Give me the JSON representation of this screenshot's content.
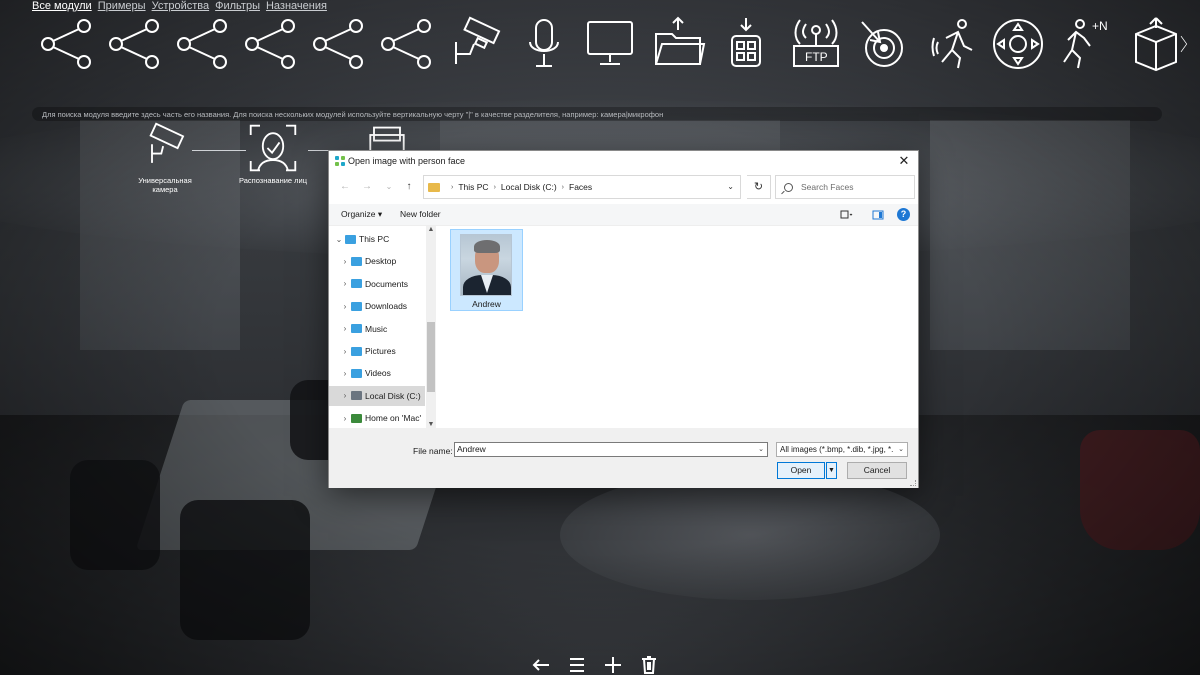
{
  "top_nav": {
    "items": [
      "Все модули",
      "Примеры",
      "Устройства",
      "Фильтры",
      "Назначения"
    ],
    "active_index": 0
  },
  "module_icons": [
    "share-icon",
    "share-icon",
    "share-icon",
    "share-icon",
    "share-icon",
    "share-icon",
    "cctv-camera-icon",
    "microphone-icon",
    "monitor-icon",
    "folder-upload-icon",
    "grid-download-icon",
    "ftp-icon",
    "motion-target-icon",
    "running-person-icon",
    "dpad-icon",
    "person-counter-icon",
    "package-icon",
    "chevron-right-icon"
  ],
  "ftp_label": "FTP",
  "counter_label": "+N",
  "search_hint": "Для поиска модуля введите здесь часть его названия. Для поиска нескольких модулей используйте вертикальную черту \"|\" в качестве разделителя, например: камера|микрофон",
  "pipeline": {
    "nodes": [
      {
        "label": "Универсальная камера",
        "icon": "cctv-camera-icon"
      },
      {
        "label": "Распознавание лиц",
        "icon": "face-recognition-icon"
      },
      {
        "label": "",
        "icon": "file-archive-icon"
      }
    ]
  },
  "bottom_toolbar": [
    "arrow-left-icon",
    "menu-icon",
    "plus-icon",
    "trash-icon"
  ],
  "dialog": {
    "title": "Open image with person face",
    "breadcrumb": [
      "This PC",
      "Local Disk (C:)",
      "Faces"
    ],
    "search_placeholder": "Search Faces",
    "commands": {
      "organize": "Organize ▾",
      "new_folder": "New folder"
    },
    "tree": [
      {
        "label": "This PC",
        "color": "#3aa0e0",
        "expanded": true
      },
      {
        "label": "Desktop",
        "color": "#3aa0e0"
      },
      {
        "label": "Documents",
        "color": "#3aa0e0"
      },
      {
        "label": "Downloads",
        "color": "#3aa0e0"
      },
      {
        "label": "Music",
        "color": "#3aa0e0"
      },
      {
        "label": "Pictures",
        "color": "#3aa0e0"
      },
      {
        "label": "Videos",
        "color": "#3aa0e0"
      },
      {
        "label": "Local Disk (C:)",
        "color": "#6b7580",
        "selected": true
      },
      {
        "label": "Home on 'Mac'",
        "color": "#3b8a3b"
      }
    ],
    "files": [
      {
        "name": "Andrew",
        "selected": true
      }
    ],
    "file_name_label": "File name:",
    "file_name_value": "Andrew",
    "file_type": "All images (*.bmp, *.dib, *.jpg, *.",
    "open_label": "Open",
    "cancel_label": "Cancel"
  }
}
